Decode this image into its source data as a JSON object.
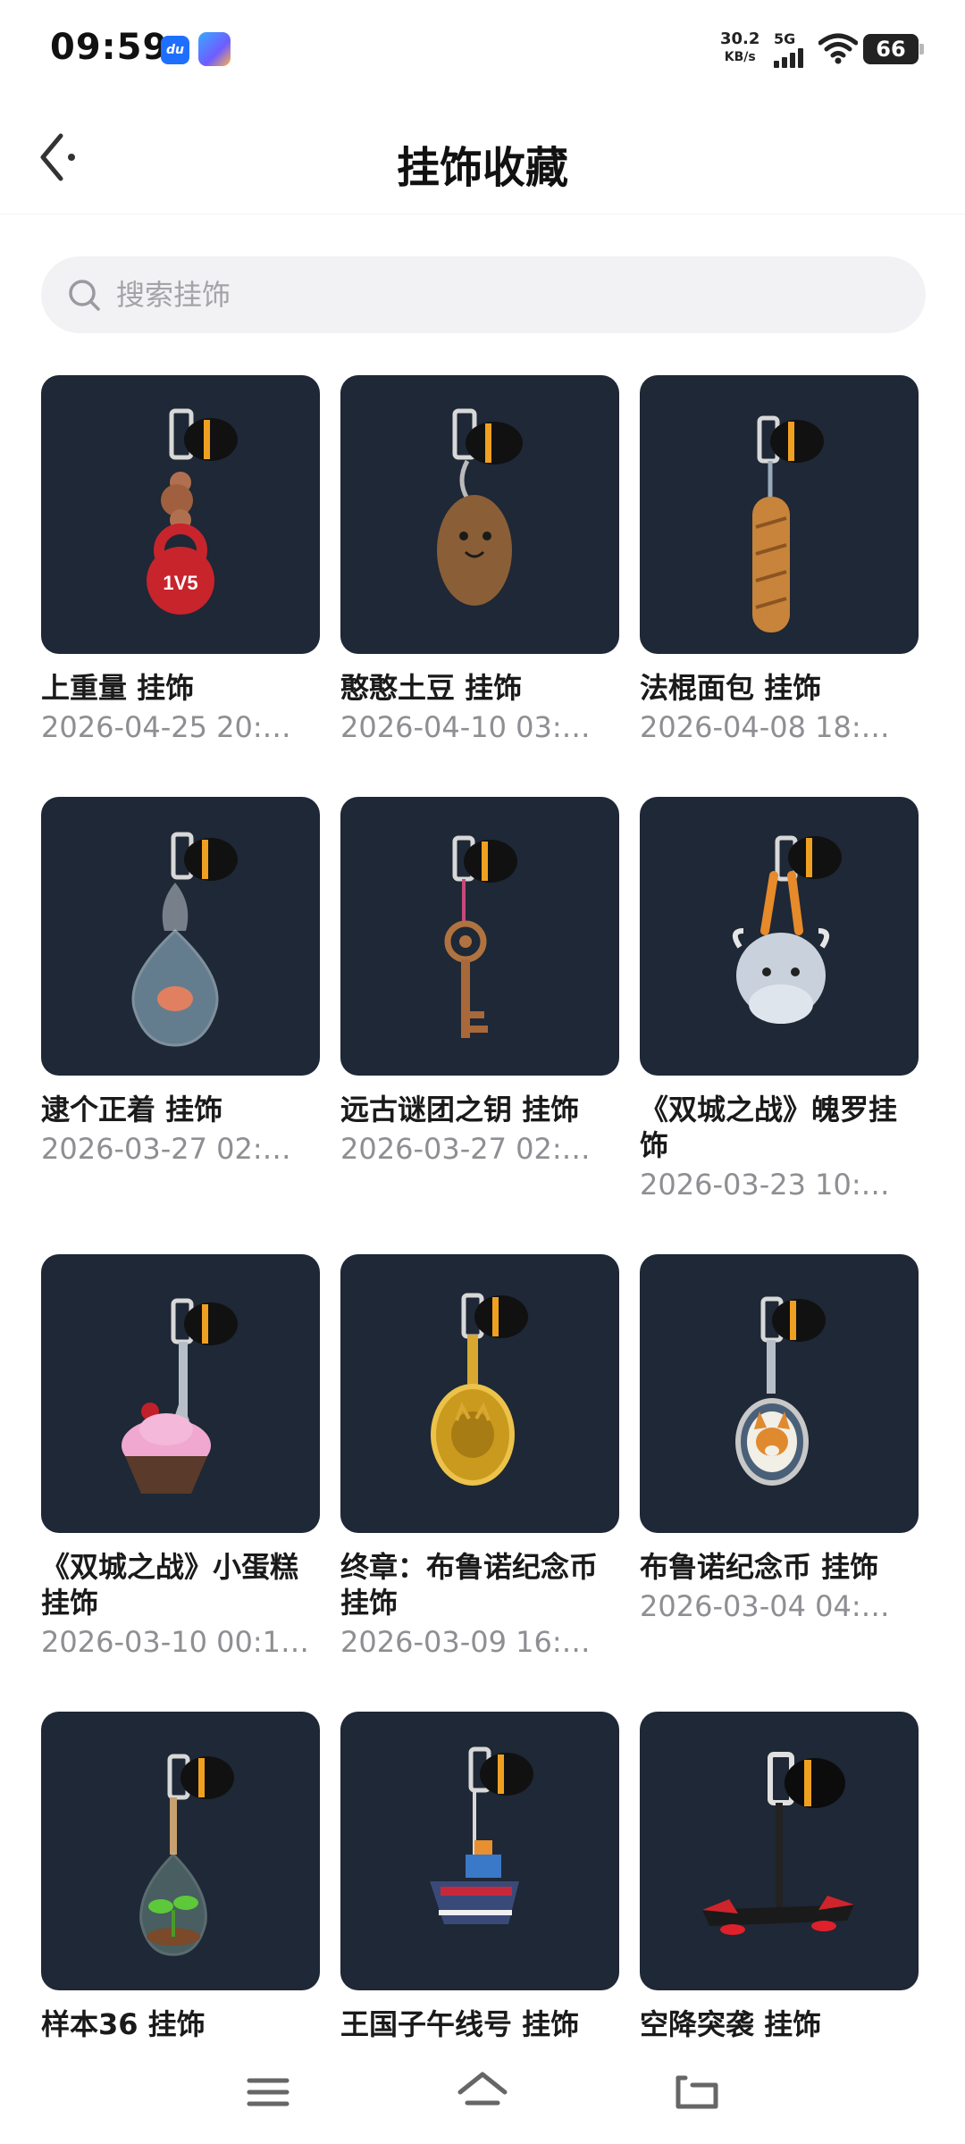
{
  "status_bar": {
    "time": "09:59",
    "net_speed_value": "30.2",
    "net_speed_unit": "KB/s",
    "network": "5G",
    "battery": "66"
  },
  "header": {
    "title": "挂饰收藏"
  },
  "search": {
    "placeholder": "搜索挂饰",
    "value": ""
  },
  "items": [
    {
      "name": " 上重量 挂饰",
      "date": "2026-04-25 20:…"
    },
    {
      "name": "憨憨土豆 挂饰",
      "date": "2026-04-10 03:…"
    },
    {
      "name": "法棍面包 挂饰",
      "date": "2026-04-08 18:…"
    },
    {
      "name": "逮个正着 挂饰",
      "date": "2026-03-27 02:…"
    },
    {
      "name": "远古谜团之钥 挂饰",
      "date": "2026-03-27 02:…"
    },
    {
      "name": "《双城之战》魄罗挂饰",
      "date": "2026-03-23 10:…"
    },
    {
      "name": "《双城之战》小蛋糕挂饰",
      "date": "2026-03-10 00:1…"
    },
    {
      "name": "终章：布鲁诺纪念币挂饰",
      "date": "2026-03-09 16:…"
    },
    {
      "name": "布鲁诺纪念币 挂饰",
      "date": "2026-03-04 04:…"
    },
    {
      "name": "样本36 挂饰",
      "date": ""
    },
    {
      "name": "王国子午线号 挂饰",
      "date": ""
    },
    {
      "name": "空降突袭 挂饰",
      "date": ""
    }
  ],
  "icons": {
    "back": "back-arrow-icon",
    "search": "search-icon",
    "nav_menu": "menu-icon",
    "nav_home": "home-icon",
    "nav_back": "return-icon"
  },
  "colors": {
    "thumb_bg": "#1e2836",
    "accent_orange": "#f0a020",
    "kettlebell_red": "#c8242c"
  }
}
